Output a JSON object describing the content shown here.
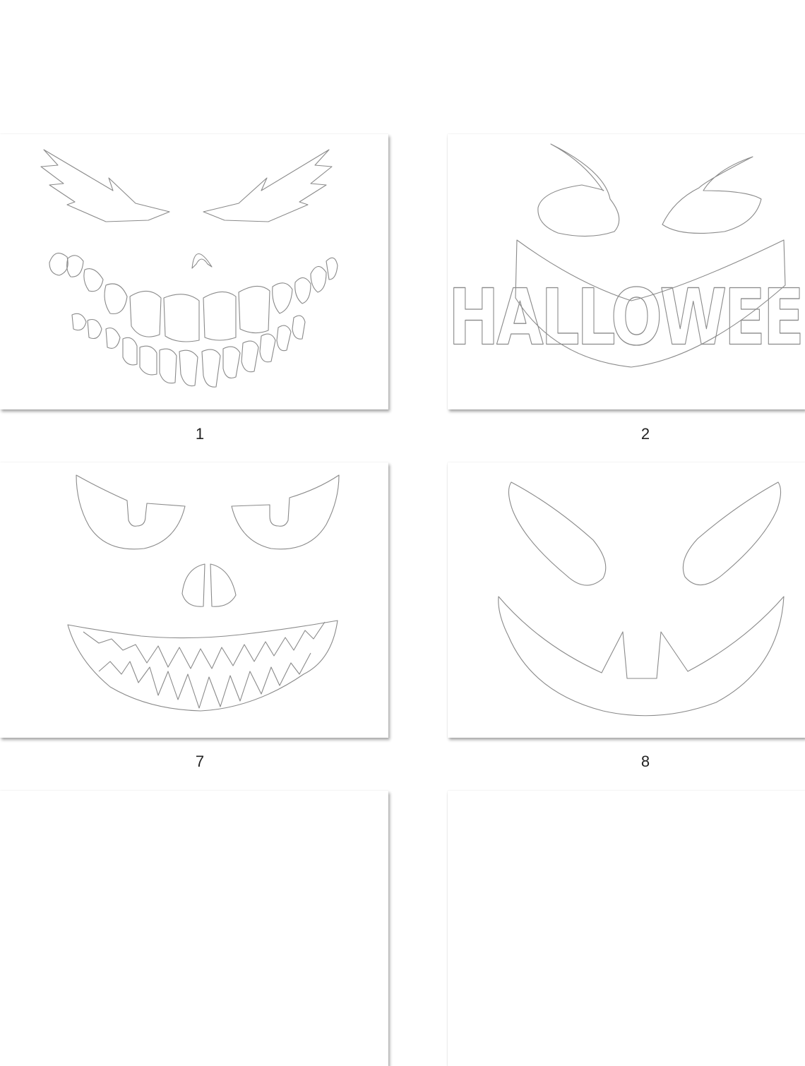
{
  "thumbnails": [
    {
      "label": "1",
      "icon": "grinning-teeth-face"
    },
    {
      "label": "2",
      "icon": "halloween-mouth-face"
    },
    {
      "label": "7",
      "icon": "skull-zigzag-teeth-face"
    },
    {
      "label": "8",
      "icon": "classic-jack-o-lantern-face"
    }
  ],
  "thumb2_mouth_text": "HALLOWEEN",
  "colors": {
    "outline": "#8a8a8a",
    "caption": "#222222",
    "background": "#ffffff"
  }
}
